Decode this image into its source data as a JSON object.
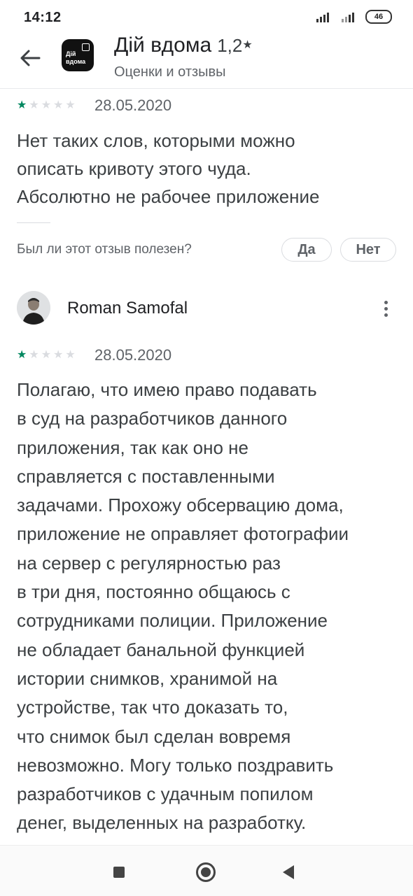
{
  "status_bar": {
    "time": "14:12",
    "battery": "46"
  },
  "header": {
    "app_logo_text": "Дій вдома",
    "title": "Дій вдома",
    "rating": "1,2",
    "star": "★",
    "subtitle": "Оценки и отзывы"
  },
  "review1": {
    "stars_filled": 1,
    "stars_total": 5,
    "date": "28.05.2020",
    "text": "Нет таких слов, которыми можно\nописать кривоту этого чуда.\nАбсолютно не рабочее приложение",
    "helpful_question": "Был ли этот отзыв полезен?",
    "yes_label": "Да",
    "no_label": "Нет"
  },
  "review2": {
    "author": "Roman Samofal",
    "stars_filled": 1,
    "stars_total": 5,
    "date": "28.05.2020",
    "text": "Полагаю, что имею право подавать\nв суд на разработчиков данного\nприложения, так как оно не\nсправляется с поставленными\nзадачами. Прохожу обсервацию дома,\nприложение не оправляет фотографии\nна сервер с регулярностью раз\nв три дня, постоянно общаюсь с\nсотрудниками полиции. Приложение\nне обладает банальной функцией\nистории снимков, хранимой на\nустройстве, так что доказать то,\nчто снимок был сделан вовремя\nневозможно. Могу только поздравить\nразработчиков с удачным попилом\nденег, выделенных на разработку."
  },
  "colors": {
    "star_on": "#01875f",
    "star_off": "#dadce0",
    "text_secondary": "#5f6368"
  }
}
